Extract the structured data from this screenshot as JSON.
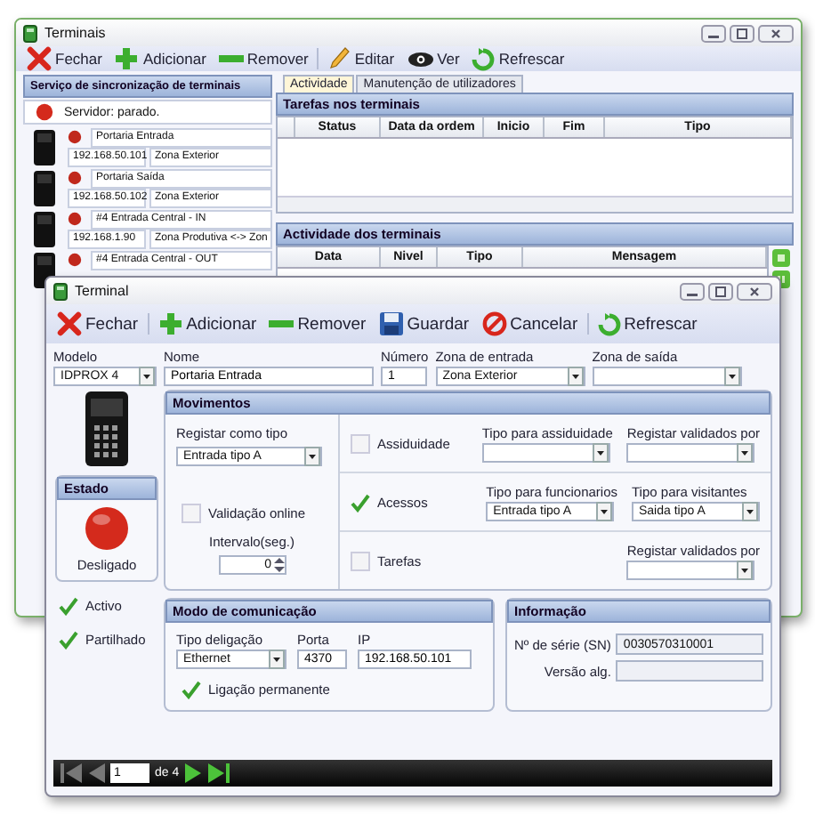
{
  "back_window": {
    "title": "Terminais",
    "toolbar": [
      {
        "label": "Fechar",
        "kind": "close"
      },
      {
        "label": "Adicionar",
        "kind": "add"
      },
      {
        "label": "Remover",
        "kind": "remove"
      },
      {
        "label": "Editar",
        "kind": "edit"
      },
      {
        "label": "Ver",
        "kind": "view"
      },
      {
        "label": "Refrescar",
        "kind": "refresh"
      }
    ],
    "sync_panel": {
      "title": "Serviço de sincronização de terminais",
      "status": "Servidor: parado.",
      "running": false
    },
    "terminals": [
      {
        "name": "Portaria Entrada",
        "ip": "192.168.50.101",
        "zone": "Zona Exterior"
      },
      {
        "name": "Portaria Saída",
        "ip": "192.168.50.102",
        "zone": "Zona Exterior"
      },
      {
        "name": "#4 Entrada Central - IN",
        "ip": "192.168.1.90",
        "zone": "Zona Produtiva <-> Zon"
      },
      {
        "name": "#4 Entrada Central - OUT"
      }
    ],
    "tabs": [
      {
        "label": "Actividade",
        "selected": true
      },
      {
        "label": "Manutenção de utilizadores",
        "selected": false
      }
    ],
    "tasks": {
      "title": "Tarefas nos terminais",
      "columns": [
        "Status",
        "Data da ordem",
        "Inicio",
        "Fim",
        "Tipo"
      ]
    },
    "activity": {
      "title": "Actividade dos terminais",
      "columns": [
        "Data",
        "Nivel",
        "Tipo",
        "Mensagem"
      ]
    }
  },
  "dialog": {
    "title": "Terminal",
    "toolbar": [
      {
        "label": "Fechar",
        "kind": "close"
      },
      {
        "label": "Adicionar",
        "kind": "add"
      },
      {
        "label": "Remover",
        "kind": "remove"
      },
      {
        "label": "Guardar",
        "kind": "save"
      },
      {
        "label": "Cancelar",
        "kind": "cancel"
      },
      {
        "label": "Refrescar",
        "kind": "refresh"
      }
    ],
    "fields": [
      {
        "label": "Modelo",
        "value": "IDPROX 4",
        "kind": "dropdown"
      },
      {
        "label": "Nome",
        "value": "Portaria Entrada",
        "kind": "text"
      },
      {
        "label": "Número",
        "value": "1",
        "kind": "text"
      },
      {
        "label": "Zona de entrada",
        "value": "Zona Exterior",
        "kind": "dropdown"
      },
      {
        "label": "Zona de saída",
        "kind": "dropdown"
      }
    ],
    "estado": {
      "title": "Estado",
      "status": "Desligado",
      "connected": false
    },
    "checks": [
      {
        "label": "Activo",
        "checked": true
      },
      {
        "label": "Partilhado",
        "checked": true
      }
    ],
    "movimentos": {
      "title": "Movimentos",
      "register_type": {
        "label": "Registar como tipo",
        "value": "Entrada tipo A"
      },
      "online_validation": {
        "label": "Validação online",
        "checked": false
      },
      "interval": {
        "label": "Intervalo(seg.)",
        "value": "0"
      },
      "rows": [
        {
          "label": "Assiduidade",
          "checked": false,
          "fields": [
            {
              "label": "Tipo para assiduidade"
            },
            {
              "label": "Registar validados por"
            }
          ]
        },
        {
          "label": "Acessos",
          "checked": true,
          "fields": [
            {
              "label": "Tipo para funcionarios",
              "value": "Entrada tipo A"
            },
            {
              "label": "Tipo para visitantes",
              "value": "Saida tipo A"
            }
          ]
        },
        {
          "label": "Tarefas",
          "checked": false,
          "fields": [
            {
              "label": "Registar validados por"
            }
          ]
        }
      ]
    },
    "communication": {
      "title": "Modo de comunicação",
      "type": {
        "label": "Tipo deligação",
        "value": "Ethernet"
      },
      "port": {
        "label": "Porta",
        "value": "4370"
      },
      "ip": {
        "label": "IP",
        "value": "192.168.50.101"
      },
      "permanent": {
        "label": "Ligação permanente",
        "checked": true
      }
    },
    "info": {
      "title": "Informação",
      "fields": [
        {
          "label": "Nº de série (SN)",
          "value": "0030570310001"
        },
        {
          "label": "Versão alg."
        }
      ]
    },
    "pager": {
      "page": "1",
      "of": "de 4"
    }
  }
}
